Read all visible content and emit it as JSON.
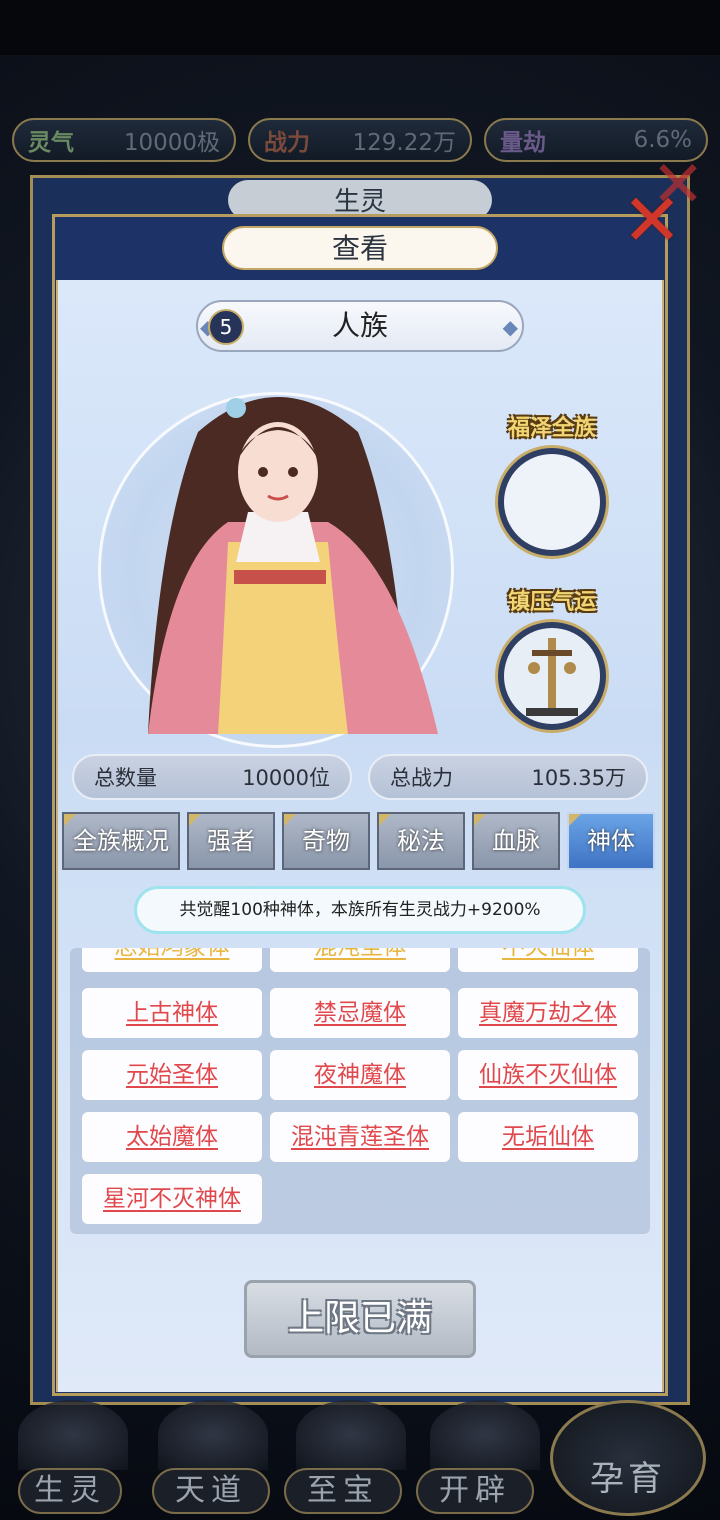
{
  "resources": [
    {
      "key": "灵气",
      "value": "10000极"
    },
    {
      "key": "战力",
      "value": "129.22万"
    },
    {
      "key": "量劫",
      "value": "6.6%"
    }
  ],
  "back_tab": "生灵",
  "dialog": {
    "title": "查看"
  },
  "race": {
    "level": "5",
    "name": "人族"
  },
  "side": {
    "blessing_label": "福泽全族",
    "suppress_label": "镇压气运"
  },
  "stats": {
    "count_label": "总数量",
    "count_value": "10000位",
    "power_label": "总战力",
    "power_value": "105.35万"
  },
  "tabs": [
    "全族概况",
    "强者",
    "奇物",
    "秘法",
    "血脉",
    "神体"
  ],
  "active_tab": "神体",
  "info_text": "共觉醒100种神体，本族所有生灵战力+9200%",
  "body_list": {
    "partial_row": [
      "总始鸿蒙体",
      "混沌圣体",
      "不灭仙体"
    ],
    "rows": [
      [
        "上古神体",
        "禁忌魔体",
        "真魔万劫之体"
      ],
      [
        "元始圣体",
        "夜神魔体",
        "仙族不灭仙体"
      ],
      [
        "太始魔体",
        "混沌青莲圣体",
        "无垢仙体"
      ],
      [
        "星河不灭神体"
      ]
    ]
  },
  "bottom_button": "上限已满",
  "nav": [
    "生灵",
    "天道",
    "至宝",
    "开辟",
    "孕育"
  ]
}
